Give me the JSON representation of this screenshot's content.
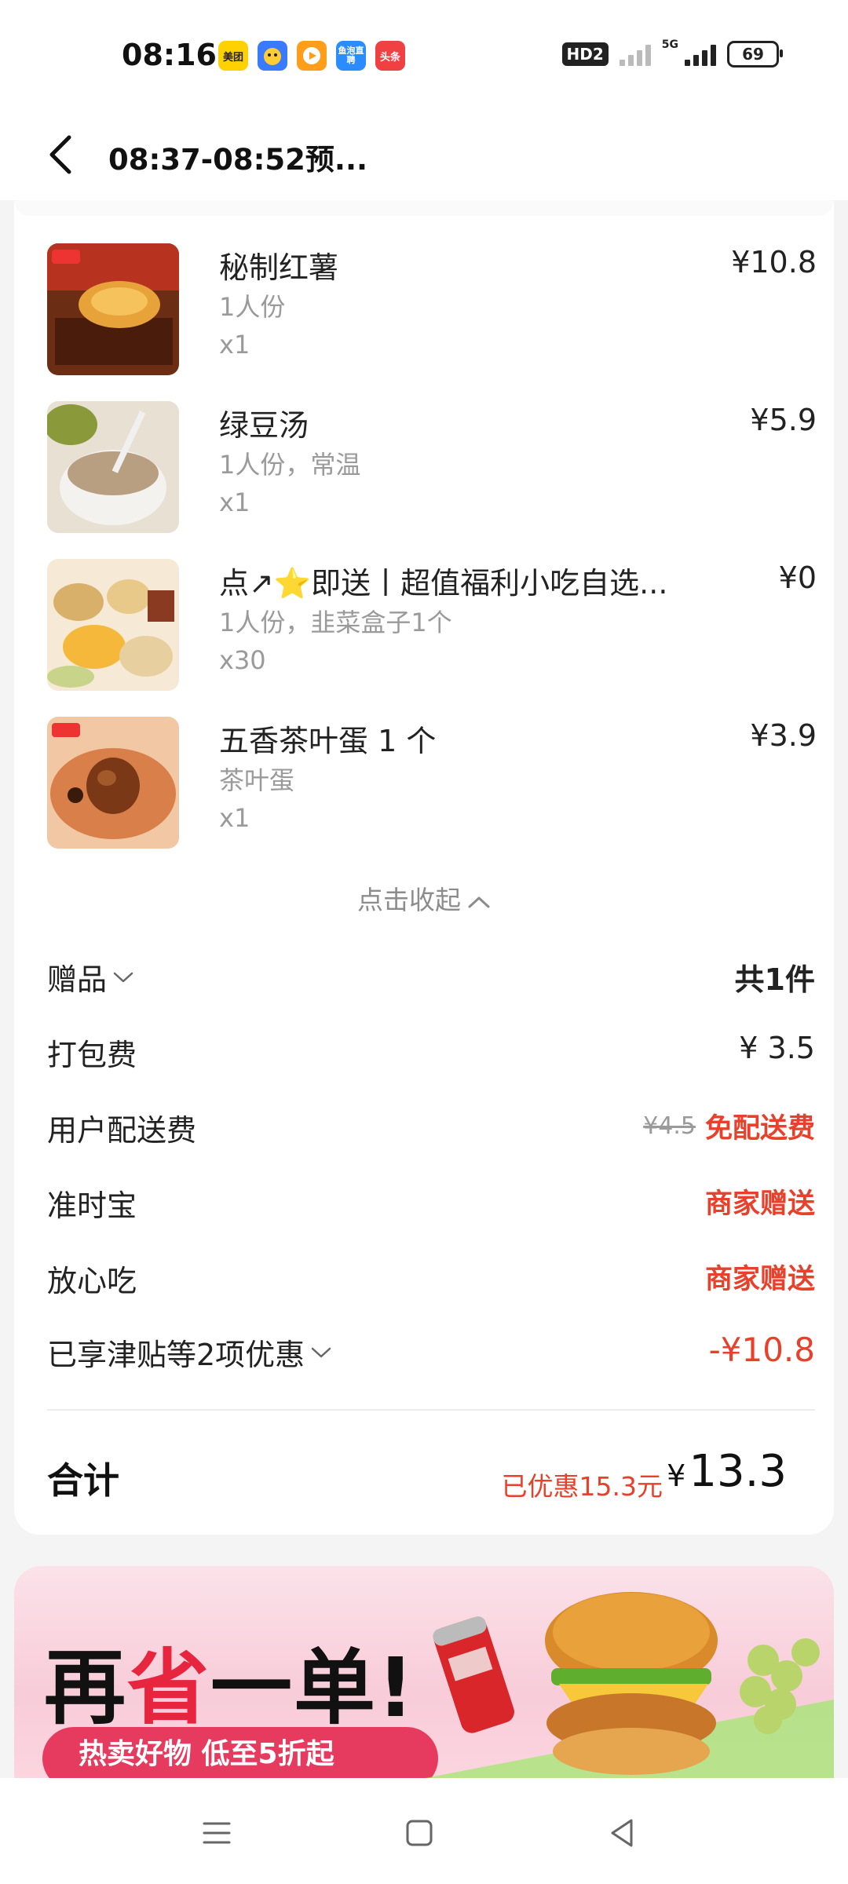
{
  "status_bar": {
    "time": "08:16",
    "app_icons": [
      {
        "label": "美团",
        "color": "#ffd100"
      },
      {
        "label": "",
        "color": "#3a7afe"
      },
      {
        "label": "",
        "color": "#ff9e1b"
      },
      {
        "label": "鱼泡直聘",
        "color": "#2a8cff"
      },
      {
        "label": "头条",
        "color": "#f04142"
      }
    ],
    "hd_label": "HD2",
    "network_label": "5G",
    "battery": "69"
  },
  "header": {
    "title": "08:37-08:52预..."
  },
  "items": [
    {
      "name": "秘制红薯",
      "spec": "1人份",
      "qty": "x1",
      "price": "¥10.8"
    },
    {
      "name": "绿豆汤",
      "spec": "1人份，常温",
      "qty": "x1",
      "price": "¥5.9"
    },
    {
      "name": "点↗⭐即送丨超值福利小吃自选...",
      "spec": "1人份，韭菜盒子1个",
      "qty": "x30",
      "price": "¥0"
    },
    {
      "name": "五香茶叶蛋 1 个",
      "spec": "茶叶蛋",
      "qty": "x1",
      "price": "¥3.9"
    }
  ],
  "collapse_label": "点击收起",
  "fees": {
    "gift": {
      "label": "赠品",
      "value": "共1件"
    },
    "packing": {
      "label": "打包费",
      "value": "¥ 3.5"
    },
    "delivery": {
      "label": "用户配送费",
      "original": "¥4.5",
      "value": "免配送费"
    },
    "ontime": {
      "label": "准时宝",
      "value": "商家赠送"
    },
    "safe": {
      "label": "放心吃",
      "value": "商家赠送"
    },
    "discount": {
      "label": "已享津贴等2项优惠",
      "value": "-¥10.8"
    }
  },
  "total": {
    "label": "合计",
    "saved": "已优惠15.3元",
    "currency": "¥",
    "amount": "13.3"
  },
  "banner": {
    "title_a": "再",
    "title_b": "省",
    "title_c": "一单!",
    "pill": "热卖好物 低至5折起"
  },
  "colors": {
    "accent_red": "#e8402b",
    "banner_pink": "#f8ccd9",
    "pill_red": "#e63a5e"
  }
}
